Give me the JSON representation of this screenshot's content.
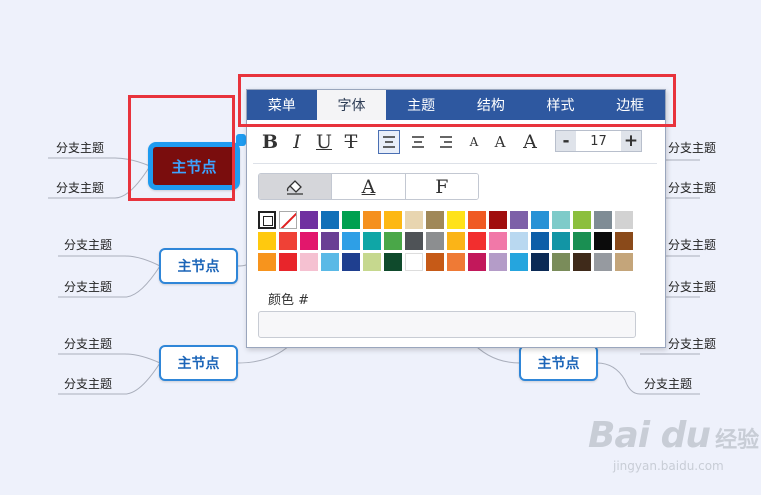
{
  "mindmap": {
    "selected_node": "主节点",
    "nodes": [
      "主节点",
      "主节点",
      "主节点"
    ],
    "branch_label": "分支主题"
  },
  "panel": {
    "tabs": [
      "菜单",
      "字体",
      "主题",
      "结构",
      "样式",
      "边框"
    ],
    "active_tab": "字体",
    "format_buttons": [
      {
        "label": "B",
        "icon": "bold-icon"
      },
      {
        "label": "I",
        "icon": "italic-icon"
      },
      {
        "label": "U",
        "icon": "underline-icon"
      },
      {
        "label": "T",
        "icon": "strikethrough-icon"
      }
    ],
    "font_sizes": [
      "A",
      "A",
      "A"
    ],
    "stepper": {
      "minus": "-",
      "value": "17",
      "plus": "+"
    },
    "color_modes": [
      {
        "icon": "fill-bucket-icon",
        "label": ""
      },
      {
        "icon": "font-color-icon",
        "label": "A"
      },
      {
        "icon": "border-color-icon",
        "label": "F"
      }
    ],
    "palette": [
      [
        "outline",
        "none",
        "#7030a0",
        "#1170b8",
        "#00a050",
        "#f5901e",
        "#fdb813",
        "#e8d5b0",
        "#a08858",
        "#ffe21a",
        "#f05a23",
        "#a00e0e",
        "#7d60a8",
        "#2792d6",
        "#7ecbc9",
        "#8cbf3e",
        "#7f8c95",
        "#d2d2d2"
      ],
      [
        "#ffc90e",
        "#ef4136",
        "#e2176c",
        "#6a3f94",
        "#2e9fe6",
        "#0fa6a6",
        "#4aa748",
        "#4f5357",
        "#8c8e90",
        "#fbb417",
        "#f22e2e",
        "#f178a8",
        "#b9d8f0",
        "#0c5ea8",
        "#1295a5",
        "#1a8f52",
        "#0b0b0b",
        "#8a4a1a"
      ],
      [
        "#f7941d",
        "#e8252b",
        "#f5c1d1",
        "#5ab9e6",
        "#1f3f8f",
        "#c6d88e",
        "#0f4a2c",
        "#ffffff",
        "#c65a17",
        "#ef7a35",
        "#c2185b",
        "#b49cc8",
        "#25a5de",
        "#0b2a55",
        "#7a8c5a",
        "#3f2a1a",
        "#969aa0",
        "#c4a57a"
      ]
    ],
    "color_label": "颜色 #",
    "color_value": ""
  },
  "watermark": {
    "brand": "Bai du",
    "brand_cn": "经验",
    "url": "jingyan.baidu.com"
  }
}
